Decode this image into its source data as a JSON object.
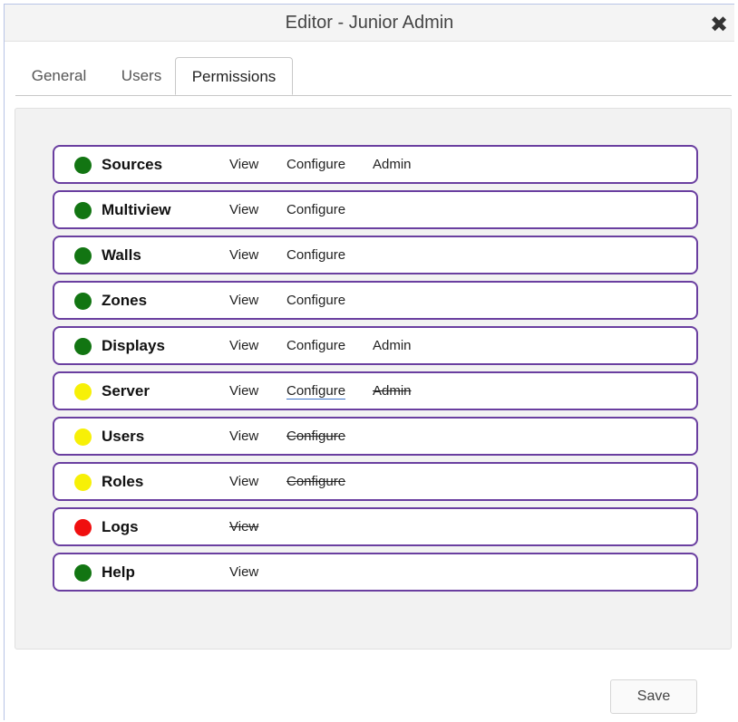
{
  "window": {
    "title": "Editor - Junior Admin",
    "close_icon": "close-icon"
  },
  "tabs": [
    {
      "label": "General"
    },
    {
      "label": "Users"
    },
    {
      "label": "Permissions",
      "active": true
    }
  ],
  "colors": {
    "green": "#127512",
    "yellow": "#f7f007",
    "red": "#f00f0f",
    "border": "#6a3fa0"
  },
  "permissions": [
    {
      "name": "Sources",
      "status": "green",
      "view": "View",
      "configure": "Configure",
      "admin": "Admin"
    },
    {
      "name": "Multiview",
      "status": "green",
      "view": "View",
      "configure": "Configure"
    },
    {
      "name": "Walls",
      "status": "green",
      "view": "View",
      "configure": "Configure"
    },
    {
      "name": "Zones",
      "status": "green",
      "view": "View",
      "configure": "Configure"
    },
    {
      "name": "Displays",
      "status": "green",
      "view": "View",
      "configure": "Configure",
      "admin": "Admin"
    },
    {
      "name": "Server",
      "status": "yellow",
      "view": "View",
      "configure": "Configure",
      "admin": "Admin",
      "configure_state": "underlined",
      "admin_state": "struck"
    },
    {
      "name": "Users",
      "status": "yellow",
      "view": "View",
      "configure": "Configure",
      "configure_state": "struck"
    },
    {
      "name": "Roles",
      "status": "yellow",
      "view": "View",
      "configure": "Configure",
      "configure_state": "struck"
    },
    {
      "name": "Logs",
      "status": "red",
      "view": "View",
      "view_state": "struck"
    },
    {
      "name": "Help",
      "status": "green",
      "view": "View"
    }
  ],
  "footer": {
    "save_label": "Save"
  }
}
